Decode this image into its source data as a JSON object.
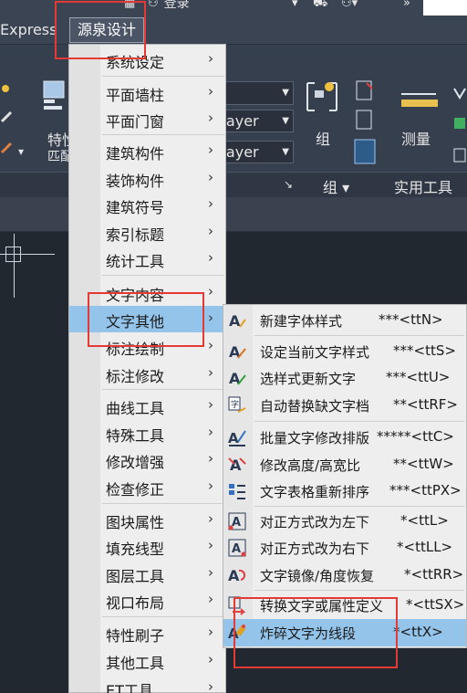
{
  "titlebar": {
    "login_label": "登录"
  },
  "menubar": {
    "express_label": "Express",
    "yq_label": "源泉设计"
  },
  "ribbon": {
    "tp_label_1": "特性",
    "tp_label_2": "匹配",
    "layer_dd_1": "Layer",
    "layer_dd_2": "Layer",
    "group_label": "组",
    "measure_label": "测量",
    "panel_group": "组",
    "panel_utilities": "实用工具"
  },
  "main_menu": {
    "items": [
      {
        "label": "系统设定"
      },
      {
        "label": "平面墙柱"
      },
      {
        "label": "平面门窗"
      },
      {
        "label": "建筑构件"
      },
      {
        "label": "装饰构件"
      },
      {
        "label": "建筑符号"
      },
      {
        "label": "索引标题"
      },
      {
        "label": "统计工具"
      },
      {
        "label": "文字内容"
      },
      {
        "label": "文字其他"
      },
      {
        "label": "标注绘制"
      },
      {
        "label": "标注修改"
      },
      {
        "label": "曲线工具"
      },
      {
        "label": "特殊工具"
      },
      {
        "label": "修改增强"
      },
      {
        "label": "检查修正"
      },
      {
        "label": "图块属性"
      },
      {
        "label": "填充线型"
      },
      {
        "label": "图层工具"
      },
      {
        "label": "视口布局"
      },
      {
        "label": "特性刷子"
      },
      {
        "label": "其他工具"
      },
      {
        "label": "ET工具"
      }
    ],
    "chevron": "›"
  },
  "sub_menu": {
    "items": [
      {
        "label": "新建字体样式",
        "cmd": "***<ttN>",
        "icon": "new-text-style-icon"
      },
      {
        "label": "设定当前文字样式",
        "cmd": "***<ttS>",
        "icon": "set-current-text-style-icon"
      },
      {
        "label": "选样式更新文字",
        "cmd": "***<ttU>",
        "icon": "update-text-by-style-icon"
      },
      {
        "label": "自动替换缺文字档",
        "cmd": "**<ttRF>",
        "icon": "replace-missing-font-icon"
      },
      {
        "label": "批量文字修改排版",
        "cmd": "*****<ttC>",
        "icon": "batch-text-edit-icon"
      },
      {
        "label": "修改高度/高宽比",
        "cmd": "**<ttW>",
        "icon": "text-height-ratio-icon"
      },
      {
        "label": "文字表格重新排序",
        "cmd": "***<ttPX>",
        "icon": "text-table-sort-icon"
      },
      {
        "label": "对正方式改为左下",
        "cmd": "*<ttL>",
        "icon": "justify-bottom-left-icon"
      },
      {
        "label": "对正方式改为右下",
        "cmd": "*<ttLL>",
        "icon": "justify-bottom-right-icon"
      },
      {
        "label": "文字镜像/角度恢复",
        "cmd": "*<ttRR>",
        "icon": "text-mirror-restore-icon"
      },
      {
        "label": "转换文字或属性定义",
        "cmd": "*<ttSX>",
        "icon": "convert-text-attdef-icon"
      },
      {
        "label": "炸碎文字为线段",
        "cmd": "*<ttX>",
        "icon": "explode-text-icon"
      }
    ]
  },
  "colors": {
    "highlight": "#94c4ea",
    "annotation_red": "#e53935",
    "menu_bg": "#eeeeee",
    "ribbon_bg": "#363f4d"
  }
}
